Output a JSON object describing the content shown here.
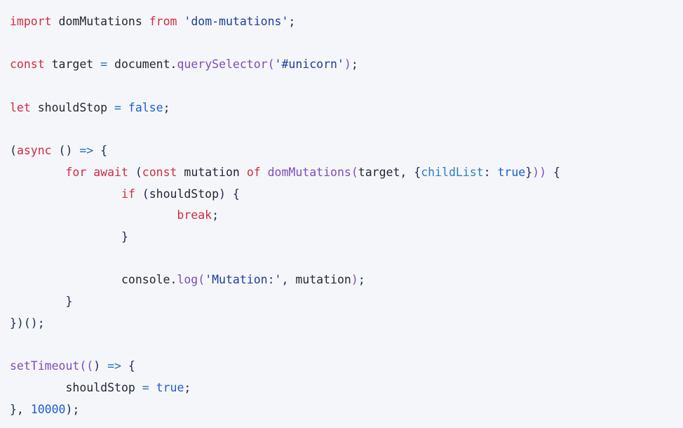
{
  "editor": {
    "language": "javascript",
    "background_color": "#f5f6f9",
    "font_size_px": 16.5,
    "line_height_px": 30.7
  },
  "theme": {
    "keyword": "#cf2c41",
    "plain": "#232733",
    "punctuation": "#1b2a54",
    "string": "#1b3d9e",
    "function": "#7c4dbd",
    "operator": "#1f72b8",
    "literal": "#1a5fd0",
    "number": "#1a5fd0",
    "property": "#2a7fc0"
  },
  "code": {
    "plain_text": "import domMutations from 'dom-mutations';\n\nconst target = document.querySelector('#unicorn');\n\nlet shouldStop = false;\n\n(async () => {\n        for await (const mutation of domMutations(target, {childList: true})) {\n                if (shouldStop) {\n                        break;\n                }\n\n                console.log('Mutation:', mutation);\n        }\n})();\n\nsetTimeout(() => {\n        shouldStop = true;\n}, 10000);",
    "lines": [
      {
        "index": 1,
        "tokens": [
          {
            "t": "import",
            "c": "keyword"
          },
          {
            "t": " ",
            "c": "ws"
          },
          {
            "t": "domMutations",
            "c": "plain"
          },
          {
            "t": " ",
            "c": "ws"
          },
          {
            "t": "from",
            "c": "keyword"
          },
          {
            "t": " ",
            "c": "ws"
          },
          {
            "t": "'dom-mutations'",
            "c": "string"
          },
          {
            "t": ";",
            "c": "punct"
          }
        ]
      },
      {
        "index": 2,
        "tokens": []
      },
      {
        "index": 3,
        "tokens": [
          {
            "t": "const",
            "c": "keyword"
          },
          {
            "t": " ",
            "c": "ws"
          },
          {
            "t": "target",
            "c": "plain"
          },
          {
            "t": " ",
            "c": "ws"
          },
          {
            "t": "=",
            "c": "operator"
          },
          {
            "t": " ",
            "c": "ws"
          },
          {
            "t": "document",
            "c": "plain"
          },
          {
            "t": ".",
            "c": "punct"
          },
          {
            "t": "querySelector",
            "c": "function"
          },
          {
            "t": "(",
            "c": "function"
          },
          {
            "t": "'#unicorn'",
            "c": "string"
          },
          {
            "t": ")",
            "c": "function"
          },
          {
            "t": ";",
            "c": "punct"
          }
        ]
      },
      {
        "index": 4,
        "tokens": []
      },
      {
        "index": 5,
        "tokens": [
          {
            "t": "let",
            "c": "keyword"
          },
          {
            "t": " ",
            "c": "ws"
          },
          {
            "t": "shouldStop",
            "c": "plain"
          },
          {
            "t": " ",
            "c": "ws"
          },
          {
            "t": "=",
            "c": "operator"
          },
          {
            "t": " ",
            "c": "ws"
          },
          {
            "t": "false",
            "c": "literal"
          },
          {
            "t": ";",
            "c": "punct"
          }
        ]
      },
      {
        "index": 6,
        "tokens": []
      },
      {
        "index": 7,
        "tokens": [
          {
            "t": "(",
            "c": "punct"
          },
          {
            "t": "async",
            "c": "keyword"
          },
          {
            "t": " ",
            "c": "ws"
          },
          {
            "t": "()",
            "c": "punct"
          },
          {
            "t": " ",
            "c": "ws"
          },
          {
            "t": "=>",
            "c": "operator"
          },
          {
            "t": " ",
            "c": "ws"
          },
          {
            "t": "{",
            "c": "punct"
          }
        ]
      },
      {
        "index": 8,
        "tokens": [
          {
            "t": "        ",
            "c": "ws"
          },
          {
            "t": "for",
            "c": "keyword"
          },
          {
            "t": " ",
            "c": "ws"
          },
          {
            "t": "await",
            "c": "keyword"
          },
          {
            "t": " ",
            "c": "ws"
          },
          {
            "t": "(",
            "c": "punct"
          },
          {
            "t": "const",
            "c": "keyword"
          },
          {
            "t": " ",
            "c": "ws"
          },
          {
            "t": "mutation",
            "c": "plain"
          },
          {
            "t": " ",
            "c": "ws"
          },
          {
            "t": "of",
            "c": "keyword"
          },
          {
            "t": " ",
            "c": "ws"
          },
          {
            "t": "domMutations",
            "c": "function"
          },
          {
            "t": "(",
            "c": "function"
          },
          {
            "t": "target",
            "c": "plain"
          },
          {
            "t": ", ",
            "c": "punct"
          },
          {
            "t": "{",
            "c": "punct"
          },
          {
            "t": "childList",
            "c": "property"
          },
          {
            "t": ":",
            "c": "punct"
          },
          {
            "t": " ",
            "c": "ws"
          },
          {
            "t": "true",
            "c": "literal"
          },
          {
            "t": "}",
            "c": "punct"
          },
          {
            "t": "))",
            "c": "function"
          },
          {
            "t": " ",
            "c": "ws"
          },
          {
            "t": "{",
            "c": "punct"
          }
        ]
      },
      {
        "index": 9,
        "tokens": [
          {
            "t": "                ",
            "c": "ws"
          },
          {
            "t": "if",
            "c": "keyword"
          },
          {
            "t": " ",
            "c": "ws"
          },
          {
            "t": "(",
            "c": "punct"
          },
          {
            "t": "shouldStop",
            "c": "plain"
          },
          {
            "t": ")",
            "c": "punct"
          },
          {
            "t": " ",
            "c": "ws"
          },
          {
            "t": "{",
            "c": "punct"
          }
        ]
      },
      {
        "index": 10,
        "tokens": [
          {
            "t": "                        ",
            "c": "ws"
          },
          {
            "t": "break",
            "c": "keyword"
          },
          {
            "t": ";",
            "c": "punct"
          }
        ]
      },
      {
        "index": 11,
        "tokens": [
          {
            "t": "                ",
            "c": "ws"
          },
          {
            "t": "}",
            "c": "punct"
          }
        ]
      },
      {
        "index": 12,
        "tokens": []
      },
      {
        "index": 13,
        "tokens": [
          {
            "t": "                ",
            "c": "ws"
          },
          {
            "t": "console",
            "c": "plain"
          },
          {
            "t": ".",
            "c": "punct"
          },
          {
            "t": "log",
            "c": "function"
          },
          {
            "t": "(",
            "c": "function"
          },
          {
            "t": "'Mutation:'",
            "c": "string"
          },
          {
            "t": ", ",
            "c": "punct"
          },
          {
            "t": "mutation",
            "c": "plain"
          },
          {
            "t": ")",
            "c": "function"
          },
          {
            "t": ";",
            "c": "punct"
          }
        ]
      },
      {
        "index": 14,
        "tokens": [
          {
            "t": "        ",
            "c": "ws"
          },
          {
            "t": "}",
            "c": "punct"
          }
        ]
      },
      {
        "index": 15,
        "tokens": [
          {
            "t": "})();",
            "c": "punct"
          }
        ]
      },
      {
        "index": 16,
        "tokens": []
      },
      {
        "index": 17,
        "tokens": [
          {
            "t": "setTimeout",
            "c": "function"
          },
          {
            "t": "((",
            "c": "function"
          },
          {
            "t": ")",
            "c": "punct"
          },
          {
            "t": " ",
            "c": "ws"
          },
          {
            "t": "=>",
            "c": "operator"
          },
          {
            "t": " ",
            "c": "ws"
          },
          {
            "t": "{",
            "c": "punct"
          }
        ]
      },
      {
        "index": 18,
        "tokens": [
          {
            "t": "        ",
            "c": "ws"
          },
          {
            "t": "shouldStop",
            "c": "plain"
          },
          {
            "t": " ",
            "c": "ws"
          },
          {
            "t": "=",
            "c": "operator"
          },
          {
            "t": " ",
            "c": "ws"
          },
          {
            "t": "true",
            "c": "literal"
          },
          {
            "t": ";",
            "c": "punct"
          }
        ]
      },
      {
        "index": 19,
        "tokens": [
          {
            "t": "}, ",
            "c": "punct"
          },
          {
            "t": "10000",
            "c": "number"
          },
          {
            "t": ");",
            "c": "punct"
          }
        ]
      }
    ]
  }
}
